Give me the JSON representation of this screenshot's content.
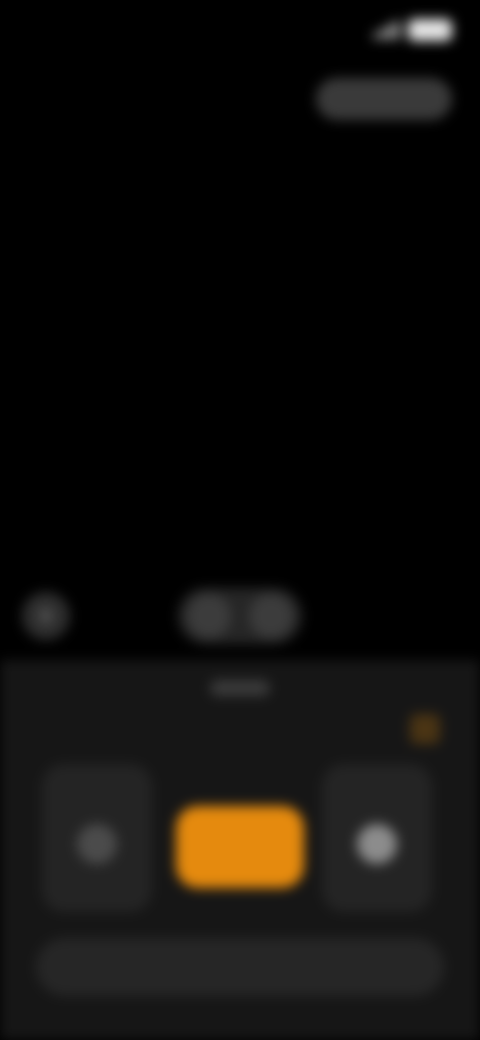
{
  "status_bar": {
    "time": "",
    "icons": [
      "signal-icon",
      "battery-icon"
    ]
  },
  "top_chip": {
    "label": ""
  },
  "zoom": {
    "options": [
      "",
      ""
    ]
  },
  "icons": {
    "flash": "flash-icon",
    "panel_corner": "settings-icon"
  },
  "mode_cards": {
    "left_label": "",
    "right_label": ""
  },
  "center_label": "",
  "action_bar": {
    "label": ""
  },
  "colors": {
    "background": "#000000",
    "panel": "#161616",
    "accent": "#e58a0e",
    "card": "#242424"
  }
}
